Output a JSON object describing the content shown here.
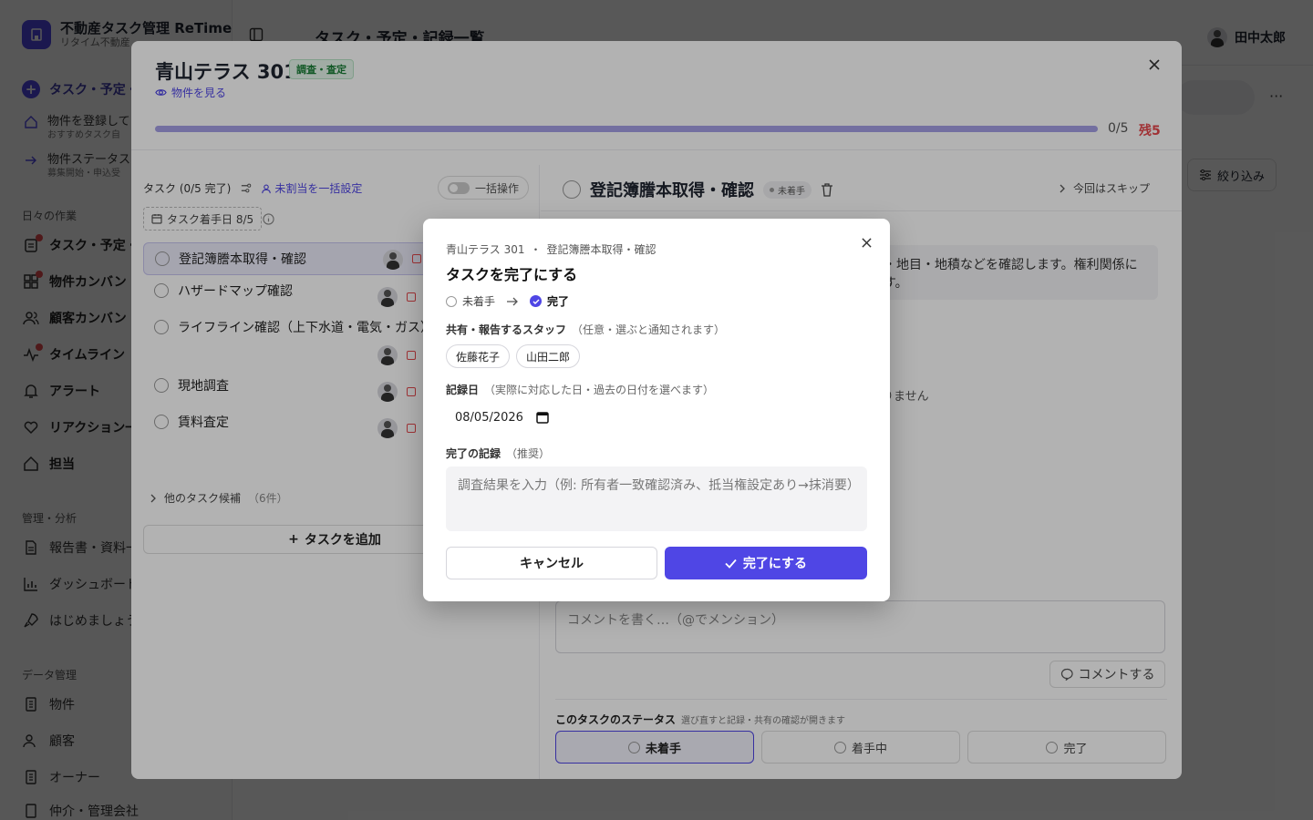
{
  "app": {
    "brand_title": "不動産タスク管理 ReTime",
    "brand_subtitle": "リタイム不動産",
    "page_title": "タスク・予定・記録一覧",
    "user_name": "田中太郎",
    "filter_label": "絞り込み",
    "more_label": "···"
  },
  "sidebar": {
    "primary_item": "タスク・予定・",
    "sub_items": [
      {
        "title": "物件を登録して",
        "subtitle": "おすすめタスク自"
      },
      {
        "title": "物件ステータスの",
        "subtitle": "募集開始・申込受"
      }
    ],
    "sections": [
      {
        "heading": "日々の作業",
        "items": [
          {
            "label": "タスク・予定・",
            "icon": "clipboard-icon",
            "badge": true
          },
          {
            "label": "物件カンバン",
            "icon": "kanban-icon",
            "badge": true
          },
          {
            "label": "顧客カンバン",
            "icon": "users-icon",
            "badge": false
          },
          {
            "label": "タイムライン",
            "icon": "activity-icon",
            "badge": true
          },
          {
            "label": "アラート",
            "icon": "bell-icon",
            "badge": false
          },
          {
            "label": "リアクション一",
            "icon": "heart-icon",
            "badge": false
          },
          {
            "label": "担当",
            "icon": "home-icon",
            "badge": false
          }
        ]
      },
      {
        "heading": "管理・分析",
        "items": [
          {
            "label": "報告書・資料一",
            "icon": "document-icon"
          },
          {
            "label": "ダッシュボード",
            "icon": "bar-chart-icon"
          },
          {
            "label": "はじめましょう",
            "icon": "rocket-icon"
          }
        ]
      },
      {
        "heading": "データ管理",
        "items": [
          {
            "label": "物件",
            "icon": "building-icon"
          },
          {
            "label": "顧客",
            "icon": "users-icon"
          },
          {
            "label": "オーナー",
            "icon": "building-icon"
          },
          {
            "label": "仲介・管理会社",
            "icon": "building-icon"
          }
        ]
      }
    ]
  },
  "drawer": {
    "property_name": "青山テラス 301",
    "phase_badge": "調査・査定",
    "view_property": "物件を見る",
    "progress": {
      "done": 0,
      "total": 5,
      "fraction": 0,
      "count_text": "0/5",
      "remaining_text": "残5"
    },
    "task_header": "タスク (0/5 完了)",
    "bulk_assign": "未割当を一括設定",
    "bulk_toggle": "一括操作",
    "start_date_chip": "タスク着手日 8/5",
    "tasks": [
      {
        "name": "登記簿謄本取得・確認",
        "selected": true
      },
      {
        "name": "ハザードマップ確認",
        "selected": false
      },
      {
        "name": "ライフライン確認（上下水道・電気・ガス）",
        "selected": false
      },
      {
        "name": "現地調査",
        "selected": false
      },
      {
        "name": "賃料査定",
        "selected": false
      }
    ],
    "task_date_glyph": "1",
    "more_candidates": "他のタスク候補",
    "more_candidates_count": "（6件）",
    "add_task": "タスクを追加",
    "detail": {
      "title": "登記簿謄本取得・確認",
      "status_badge": "未着手",
      "skip": "今回はスキップ",
      "description": "・地目・地積などを確認します。権利関係に\nす。",
      "note_fragment": "りません",
      "comment_placeholder": "コメントを書く…（@でメンション）",
      "comment_button": "コメントする",
      "status_title": "このタスクのステータス",
      "status_hint": "選び直すと記録・共有の確認が開きます",
      "status_options": [
        "未着手",
        "着手中",
        "完了"
      ]
    }
  },
  "dialog": {
    "crumb_property": "青山テラス 301",
    "crumb_separator": "・",
    "crumb_task": "登記簿謄本取得・確認",
    "title": "タスクを完了にする",
    "from_status": "未着手",
    "to_status": "完了",
    "staff_label": "共有・報告するスタッフ",
    "staff_hint": "（任意・選ぶと通知されます）",
    "staff": [
      "佐藤花子",
      "山田二郎"
    ],
    "date_label": "記録日",
    "date_hint": "（実際に対応した日・過去の日付を選べます）",
    "date_value": "08/05/2026",
    "note_label": "完了の記録",
    "note_hint": "（推奨）",
    "note_placeholder": "調査結果を入力（例: 所有者一致確認済み、抵当権設定あり→抹消要）",
    "cancel": "キャンセル",
    "confirm": "完了にする",
    "accent_color": "#4f46e5"
  }
}
